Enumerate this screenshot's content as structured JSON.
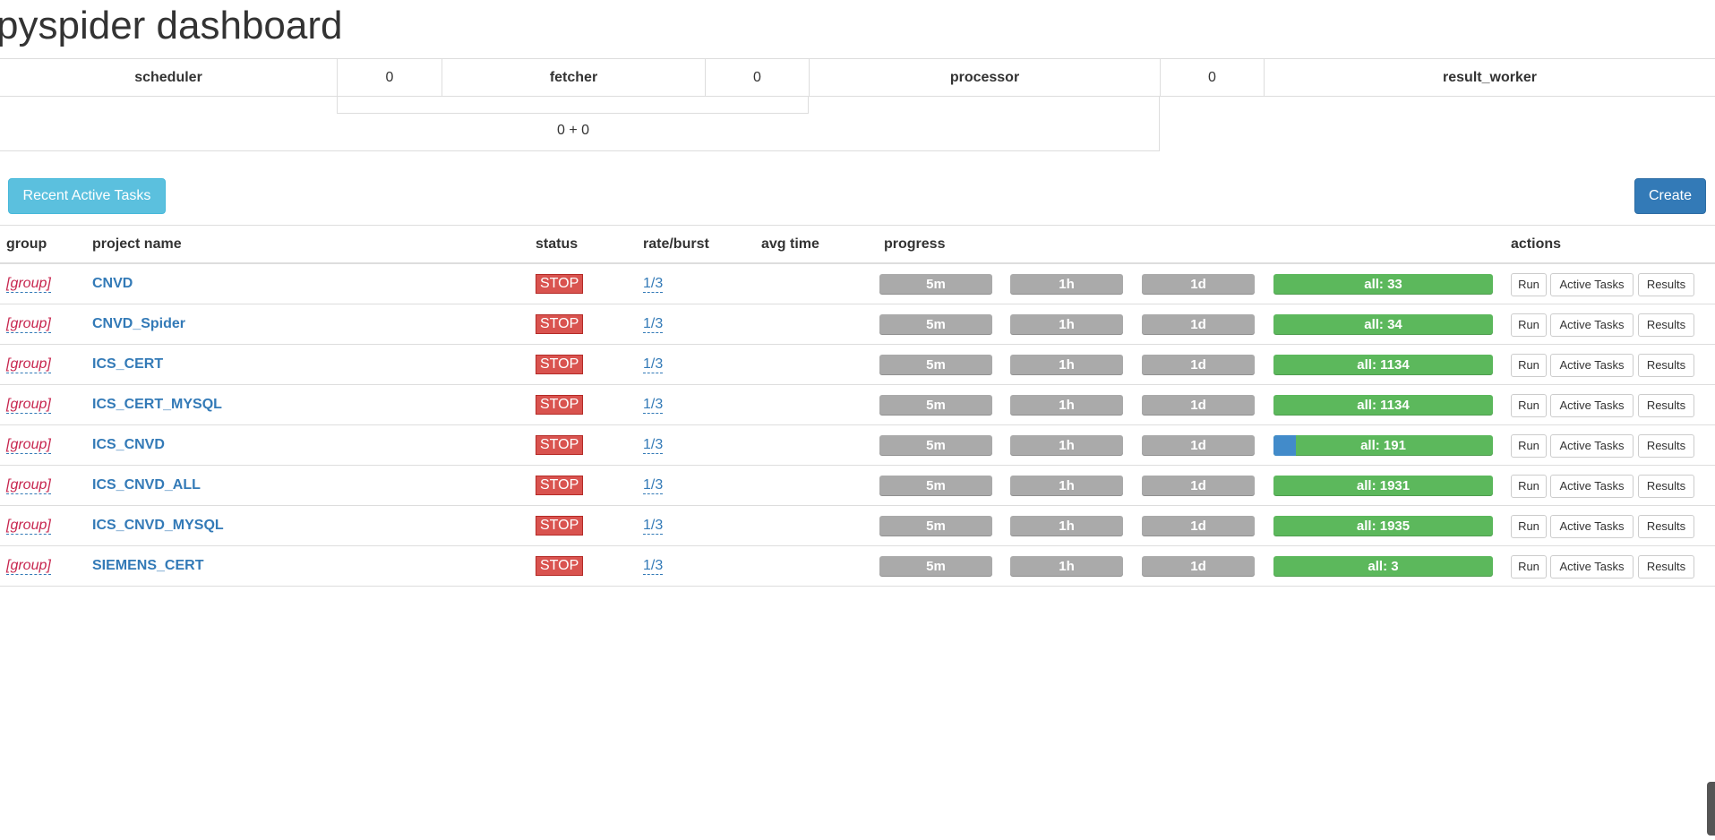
{
  "page": {
    "title": "pyspider dashboard"
  },
  "queues": {
    "scheduler_label": "scheduler",
    "scheduler_to_fetcher": "0",
    "fetcher_label": "fetcher",
    "fetcher_to_processor": "0",
    "processor_label": "processor",
    "processor_to_result": "0",
    "result_worker_label": "result_worker",
    "sum_text": "0 + 0"
  },
  "toolbar": {
    "recent_active_tasks_label": "Recent Active Tasks",
    "create_label": "Create"
  },
  "table": {
    "headers": {
      "group": "group",
      "project_name": "project name",
      "status": "status",
      "rate_burst": "rate/burst",
      "avg_time": "avg time",
      "progress": "progress",
      "actions": "actions"
    },
    "progress_labels": {
      "m5": "5m",
      "h1": "1h",
      "d1": "1d"
    },
    "action_labels": {
      "run": "Run",
      "active_tasks": "Active Tasks",
      "results": "Results"
    },
    "rows": [
      {
        "group": "[group]",
        "name": "CNVD",
        "status": "STOP",
        "rate": "1/3",
        "all": "all: 33",
        "pending_fraction": 0
      },
      {
        "group": "[group]",
        "name": "CNVD_Spider",
        "status": "STOP",
        "rate": "1/3",
        "all": "all: 34",
        "pending_fraction": 0
      },
      {
        "group": "[group]",
        "name": "ICS_CERT",
        "status": "STOP",
        "rate": "1/3",
        "all": "all: 1134",
        "pending_fraction": 0
      },
      {
        "group": "[group]",
        "name": "ICS_CERT_MYSQL",
        "status": "STOP",
        "rate": "1/3",
        "all": "all: 1134",
        "pending_fraction": 0
      },
      {
        "group": "[group]",
        "name": "ICS_CNVD",
        "status": "STOP",
        "rate": "1/3",
        "all": "all: 191",
        "pending_fraction": 0.1
      },
      {
        "group": "[group]",
        "name": "ICS_CNVD_ALL",
        "status": "STOP",
        "rate": "1/3",
        "all": "all: 1931",
        "pending_fraction": 0
      },
      {
        "group": "[group]",
        "name": "ICS_CNVD_MYSQL",
        "status": "STOP",
        "rate": "1/3",
        "all": "all: 1935",
        "pending_fraction": 0
      },
      {
        "group": "[group]",
        "name": "SIEMENS_CERT",
        "status": "STOP",
        "rate": "1/3",
        "all": "all: 3",
        "pending_fraction": 0
      }
    ]
  },
  "colors": {
    "stop": "#d9534f",
    "progress_idle": "#aaaaaa",
    "progress_success": "#5cb85c",
    "progress_pending": "#428bca",
    "link": "#337ab7",
    "group": "#c7254e"
  }
}
